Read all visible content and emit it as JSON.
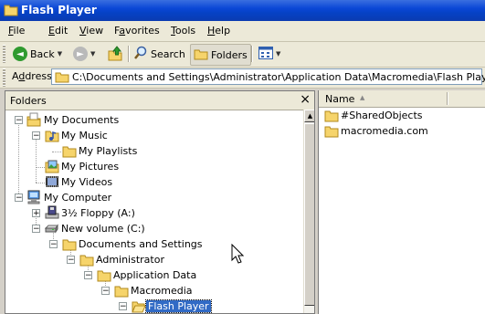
{
  "window": {
    "title": "Flash Player"
  },
  "menu": [
    {
      "key": "F",
      "rest": "ile"
    },
    {
      "key": "E",
      "rest": "dit"
    },
    {
      "key": "V",
      "rest": "iew"
    },
    {
      "key": "a",
      "pre": "F",
      "rest": "vorites"
    },
    {
      "key": "T",
      "rest": "ools"
    },
    {
      "key": "H",
      "rest": "elp"
    }
  ],
  "toolbar": {
    "back_label": "Back",
    "search_label": "Search",
    "folders_label": "Folders"
  },
  "address": {
    "label_key": "d",
    "label_pre": "A",
    "label_rest": "dress",
    "value": "C:\\Documents and Settings\\Administrator\\Application Data\\Macromedia\\Flash Player"
  },
  "folders": {
    "title": "Folders",
    "close": "×"
  },
  "tree": [
    {
      "label": "My Documents",
      "expander": "minus"
    },
    {
      "label": "My Music",
      "expander": "minus"
    },
    {
      "label": "My Playlists"
    },
    {
      "label": "My Pictures"
    },
    {
      "label": "My Videos"
    },
    {
      "label": "My Computer",
      "expander": "minus"
    },
    {
      "label": "3½ Floppy (A:)",
      "expander": "plus"
    },
    {
      "label": "New volume (C:)",
      "expander": "minus"
    },
    {
      "label": "Documents and Settings",
      "expander": "minus"
    },
    {
      "label": "Administrator",
      "expander": "minus"
    },
    {
      "label": "Application Data",
      "expander": "minus"
    },
    {
      "label": "Macromedia",
      "expander": "minus"
    },
    {
      "label": "Flash Player",
      "expander": "minus",
      "selected": true
    }
  ],
  "list": {
    "column_name": "Name",
    "items": [
      "#SharedObjects",
      "macromedia.com"
    ]
  }
}
